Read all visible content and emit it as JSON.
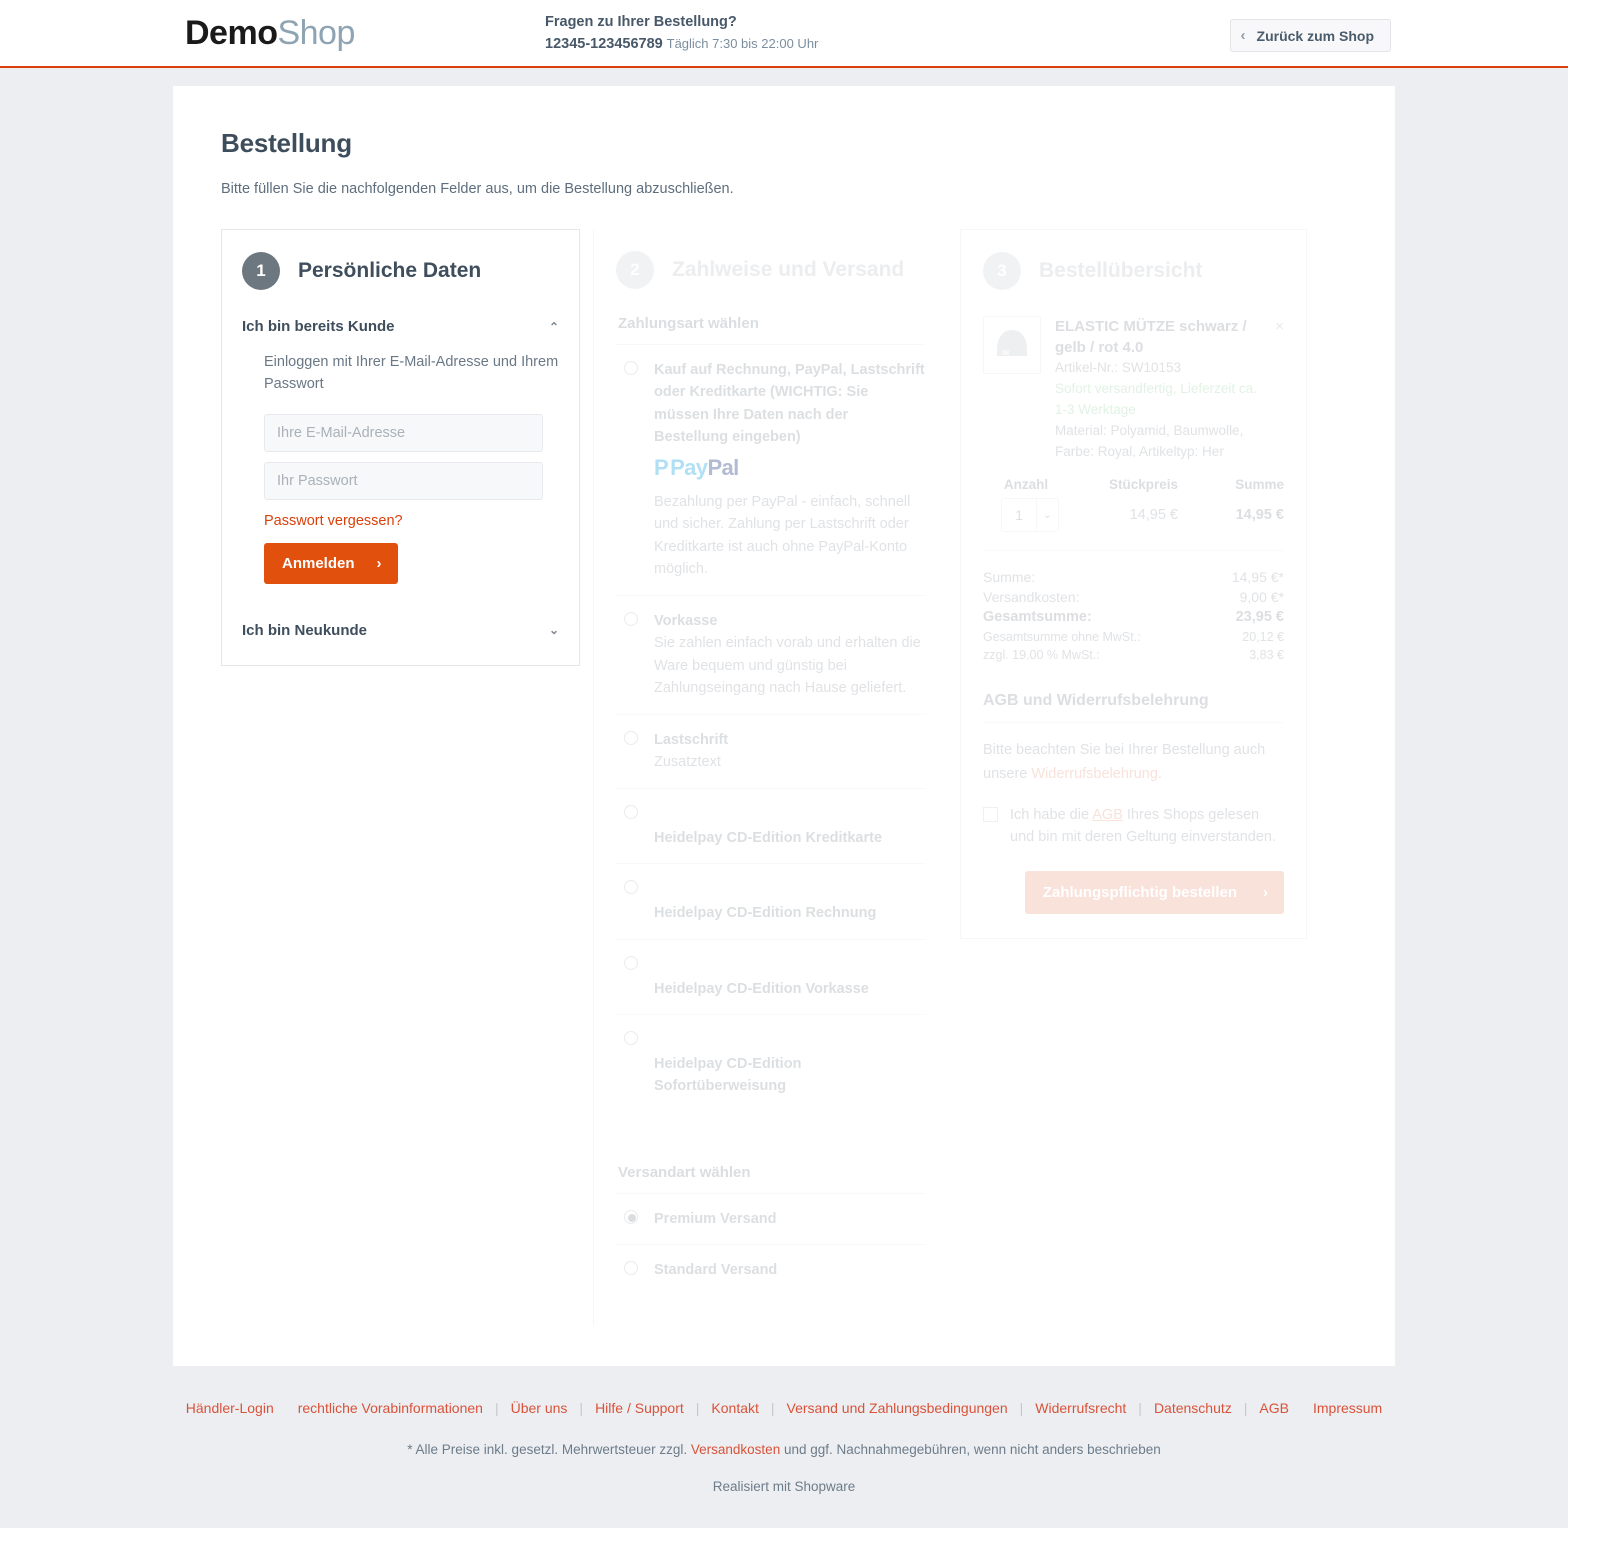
{
  "header": {
    "logo_demo": "Demo",
    "logo_shop": "Shop",
    "contact_question": "Fragen zu Ihrer Bestellung?",
    "contact_phone": "12345-123456789",
    "contact_hours": "Täglich 7:30 bis 22:00 Uhr",
    "back_label": "Zurück zum Shop",
    "back_chevron": "‹"
  },
  "main": {
    "title": "Bestellung",
    "intro": "Bitte füllen Sie die nachfolgenden Felder aus, um die Bestellung abzuschließen."
  },
  "step1": {
    "number": "1",
    "title": "Persönliche Daten",
    "existing_customer_label": "Ich bin bereits Kunde",
    "existing_caret": "⌃",
    "login_hint": "Einloggen mit Ihrer E-Mail-Adresse und Ihrem Passwort",
    "email_placeholder": "Ihre E-Mail-Adresse",
    "email_value": "",
    "password_placeholder": "Ihr Passwort",
    "password_value": "",
    "forgot_label": "Passwort vergessen?",
    "login_button": "Anmelden",
    "login_button_arrow": "›",
    "new_customer_label": "Ich bin Neukunde",
    "new_caret": "⌄"
  },
  "step2": {
    "number": "2",
    "title": "Zahlweise und Versand",
    "payment_heading": "Zahlungsart wählen",
    "payments": [
      {
        "label": "Kauf auf Rechnung, PayPal, Lastschrift oder Kreditkarte (WICHTIG: Sie müssen Ihre Daten nach der Bestellung eingeben)",
        "logo_1": "Pay",
        "logo_2": "Pal",
        "desc": "Bezahlung per PayPal - einfach, schnell und sicher. Zahlung per Lastschrift oder Kreditkarte ist auch ohne PayPal-Konto möglich.",
        "selected": false
      },
      {
        "label": "Vorkasse",
        "desc": "Sie zahlen einfach vorab und erhalten die Ware bequem und günstig bei Zahlungseingang nach Hause geliefert.",
        "selected": false
      },
      {
        "label": "Lastschrift",
        "desc": "Zusatztext",
        "selected": false
      },
      {
        "label": "Heidelpay CD-Edition Kreditkarte",
        "desc": "",
        "selected": false,
        "offset": true
      },
      {
        "label": "Heidelpay CD-Edition Rechnung",
        "desc": "",
        "selected": false,
        "offset": true
      },
      {
        "label": "Heidelpay CD-Edition Vorkasse",
        "desc": "",
        "selected": false,
        "offset": true
      },
      {
        "label": "Heidelpay CD-Edition Sofortüberweisung",
        "desc": "",
        "selected": false,
        "offset": true
      }
    ],
    "shipping_heading": "Versandart wählen",
    "shippings": [
      {
        "label": "Premium Versand",
        "selected": true
      },
      {
        "label": "Standard Versand",
        "selected": false
      }
    ]
  },
  "step3": {
    "number": "3",
    "title": "Bestellübersicht",
    "remove_icon": "×",
    "item": {
      "name": "ELASTIC MÜTZE schwarz / gelb / rot 4.0",
      "article_number": "Artikel-Nr.: SW10153",
      "availability": "Sofort versandfertig, Lieferzeit ca. 1-3 Werktage",
      "attributes": "Material: Polyamid, Baumwolle, Farbe: Royal, Artikeltyp: Her",
      "qty_value": "1",
      "qty_caret": "⌄"
    },
    "table_headers": {
      "qty": "Anzahl",
      "unit_price": "Stückpreis",
      "sum": "Summe"
    },
    "table_row": {
      "unit_price": "14,95 €",
      "sum": "14,95 €"
    },
    "totals": [
      {
        "label": "Summe:",
        "value": "14,95 €*",
        "bold": false,
        "small": false
      },
      {
        "label": "Versandkosten:",
        "value": "9,00 €*",
        "bold": false,
        "small": false
      },
      {
        "label": "Gesamtsumme:",
        "value": "23,95 €",
        "bold": true,
        "small": false
      },
      {
        "label": "Gesamtsumme ohne MwSt.:",
        "value": "20,12 €",
        "bold": false,
        "small": true
      },
      {
        "label": "zzgl. 19.00 % MwSt.:",
        "value": "3,83 €",
        "bold": false,
        "small": true
      }
    ],
    "agb_heading": "AGB und Widerrufsbelehrung",
    "agb_text_before": "Bitte beachten Sie bei Ihrer Bestellung auch unsere ",
    "agb_text_link": "Widerrufsbelehrung",
    "agb_text_after": ".",
    "agb_check_before": "Ich habe die ",
    "agb_check_link": "AGB",
    "agb_check_after": " Ihres Shops gelesen und bin mit deren Geltung einverstanden.",
    "agb_checked": false,
    "order_button": "Zahlungspflichtig bestellen",
    "order_button_arrow": "›"
  },
  "footer": {
    "links": [
      "Händler-Login",
      "rechtliche Vorabinformationen",
      "Über uns",
      "Hilfe / Support",
      "Kontakt",
      "Versand und Zahlungsbedingungen",
      "Widerrufsrecht",
      "Datenschutz",
      "AGB",
      "Impressum"
    ],
    "separator": "|",
    "note_before": "* Alle Preise inkl. gesetzl. Mehrwertsteuer zzgl. ",
    "note_link": "Versandkosten",
    "note_after": " und ggf. Nachnahmegebühren, wenn nicht anders beschrieben",
    "realized": "Realisiert mit Shopware"
  },
  "colors": {
    "accent": "#d9400b",
    "button": "#e2500d",
    "link": "#d9533a",
    "muted": "#9aa2aa",
    "available": "#9fd7a8"
  }
}
